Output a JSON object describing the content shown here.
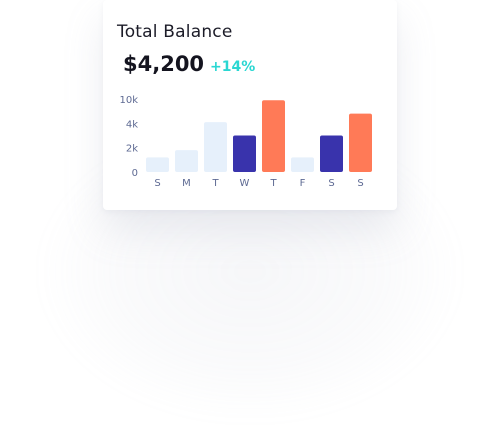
{
  "card": {
    "title": "Total Balance",
    "amount": "$4,200",
    "change": "+14%"
  },
  "colors": {
    "light": "#e6f0fb",
    "navy": "#3933ac",
    "coral": "#ff7a57",
    "accent_teal": "#2ad7d2",
    "tick": "#5e6a93"
  },
  "chart_data": {
    "type": "bar",
    "categories": [
      "S",
      "M",
      "T",
      "W",
      "T",
      "F",
      "S",
      "S"
    ],
    "values": [
      1.2,
      1.8,
      4.1,
      3.0,
      5.9,
      1.2,
      3.0,
      4.8
    ],
    "bar_colors": [
      "light",
      "light",
      "light",
      "navy",
      "coral",
      "light",
      "navy",
      "coral"
    ],
    "y_ticks": [
      {
        "label": "10k",
        "value": 6.0
      },
      {
        "label": "4k",
        "value": 4.0
      },
      {
        "label": "2k",
        "value": 2.0
      },
      {
        "label": "0",
        "value": 0
      }
    ],
    "ylim": [
      0,
      6.0
    ],
    "grid": false,
    "title": "",
    "xlabel": "",
    "ylabel": ""
  }
}
